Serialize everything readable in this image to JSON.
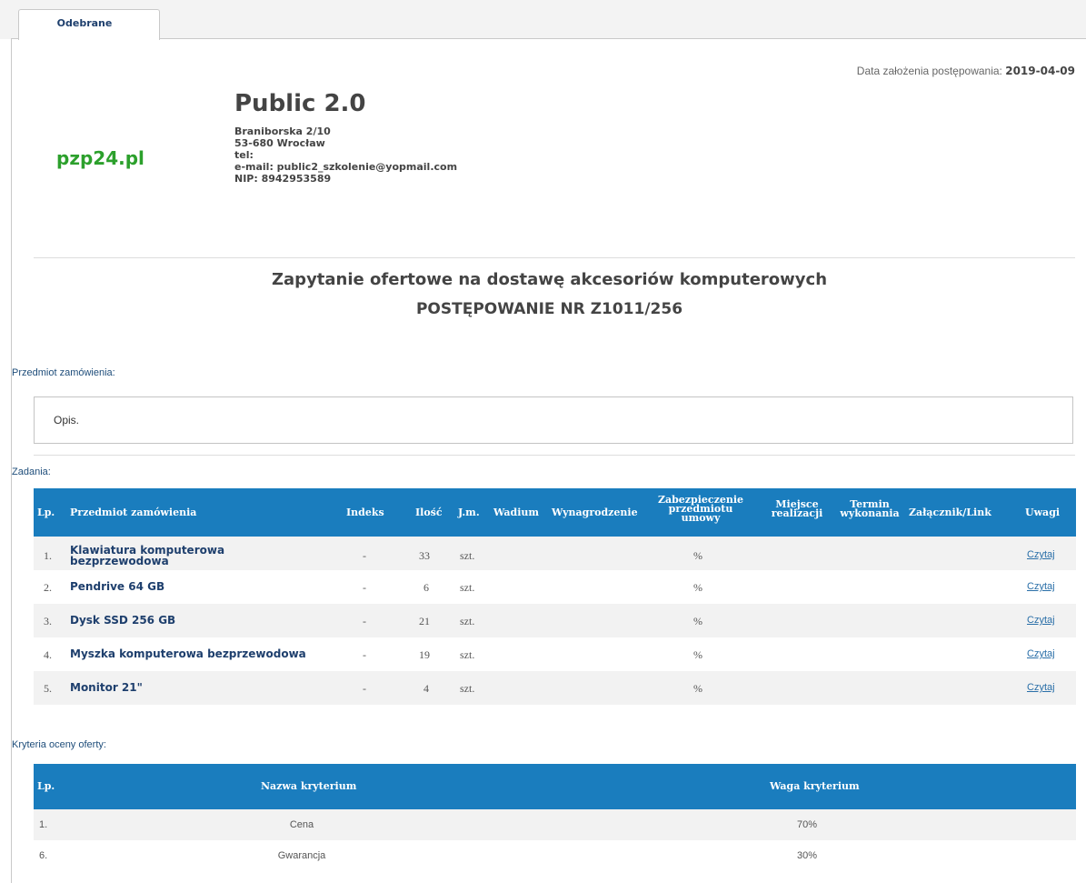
{
  "tab": {
    "label": "Odebrane"
  },
  "header": {
    "date_label": "Data założenia postępowania:",
    "date_value": "2019-04-09",
    "logo_text": "pzp24.pl",
    "org_name": "Public 2.0",
    "address": "Braniborska 2/10",
    "city": "53-680 Wrocław",
    "tel": "tel:",
    "email": "e-mail: public2_szkolenie@yopmail.com",
    "nip": "NIP: 8942953589"
  },
  "notice": {
    "title": "Zapytanie ofertowe na dostawę akcesoriów komputerowych",
    "subtitle": "POSTĘPOWANIE NR Z1011/256"
  },
  "subject": {
    "label": "Przedmiot zamówienia:",
    "description": "Opis."
  },
  "tasks": {
    "label": "Zadania:",
    "columns": {
      "lp": "Lp.",
      "name": "Przedmiot zamówienia",
      "index": "Indeks",
      "qty": "Ilość",
      "unit": "J.m.",
      "deposit": "Wadium",
      "fee": "Wynagrodzenie",
      "security_1": "Zabezpieczenie",
      "security_2": "przedmiotu",
      "security_3": "umowy",
      "place_1": "Miejsce",
      "place_2": "realizacji",
      "term_1": "Termin",
      "term_2": "wykonania",
      "attachment": "Załącznik/Link",
      "notes": "Uwagi"
    },
    "rows": [
      {
        "lp": "1.",
        "name_1": "Klawiatura komputerowa",
        "name_2": "bezprzewodowa",
        "index": "-",
        "qty": "33",
        "unit": "szt.",
        "security": "%",
        "notes": "Czytaj"
      },
      {
        "lp": "2.",
        "name_1": "Pendrive 64 GB",
        "name_2": "",
        "index": "-",
        "qty": "6",
        "unit": "szt.",
        "security": "%",
        "notes": "Czytaj"
      },
      {
        "lp": "3.",
        "name_1": "Dysk SSD 256 GB",
        "name_2": "",
        "index": "-",
        "qty": "21",
        "unit": "szt.",
        "security": "%",
        "notes": "Czytaj"
      },
      {
        "lp": "4.",
        "name_1": "Myszka komputerowa bezprzewodowa",
        "name_2": "",
        "index": "-",
        "qty": "19",
        "unit": "szt.",
        "security": "%",
        "notes": "Czytaj"
      },
      {
        "lp": "5.",
        "name_1": "Monitor 21\"",
        "name_2": "",
        "index": "-",
        "qty": "4",
        "unit": "szt.",
        "security": "%",
        "notes": "Czytaj"
      }
    ]
  },
  "criteria": {
    "label": "Kryteria oceny oferty:",
    "columns": {
      "lp": "Lp.",
      "name": "Nazwa kryterium",
      "weight": "Waga kryterium"
    },
    "rows": [
      {
        "lp": "1.",
        "name": "Cena",
        "weight": "70%"
      },
      {
        "lp": "6.",
        "name": "Gwarancja",
        "weight": "30%"
      }
    ]
  },
  "colors": {
    "header_blue": "#1a7dbe",
    "link_blue": "#2a6fa8",
    "name_navy": "#1e3f6d",
    "logo_green": "#2ca02c"
  }
}
